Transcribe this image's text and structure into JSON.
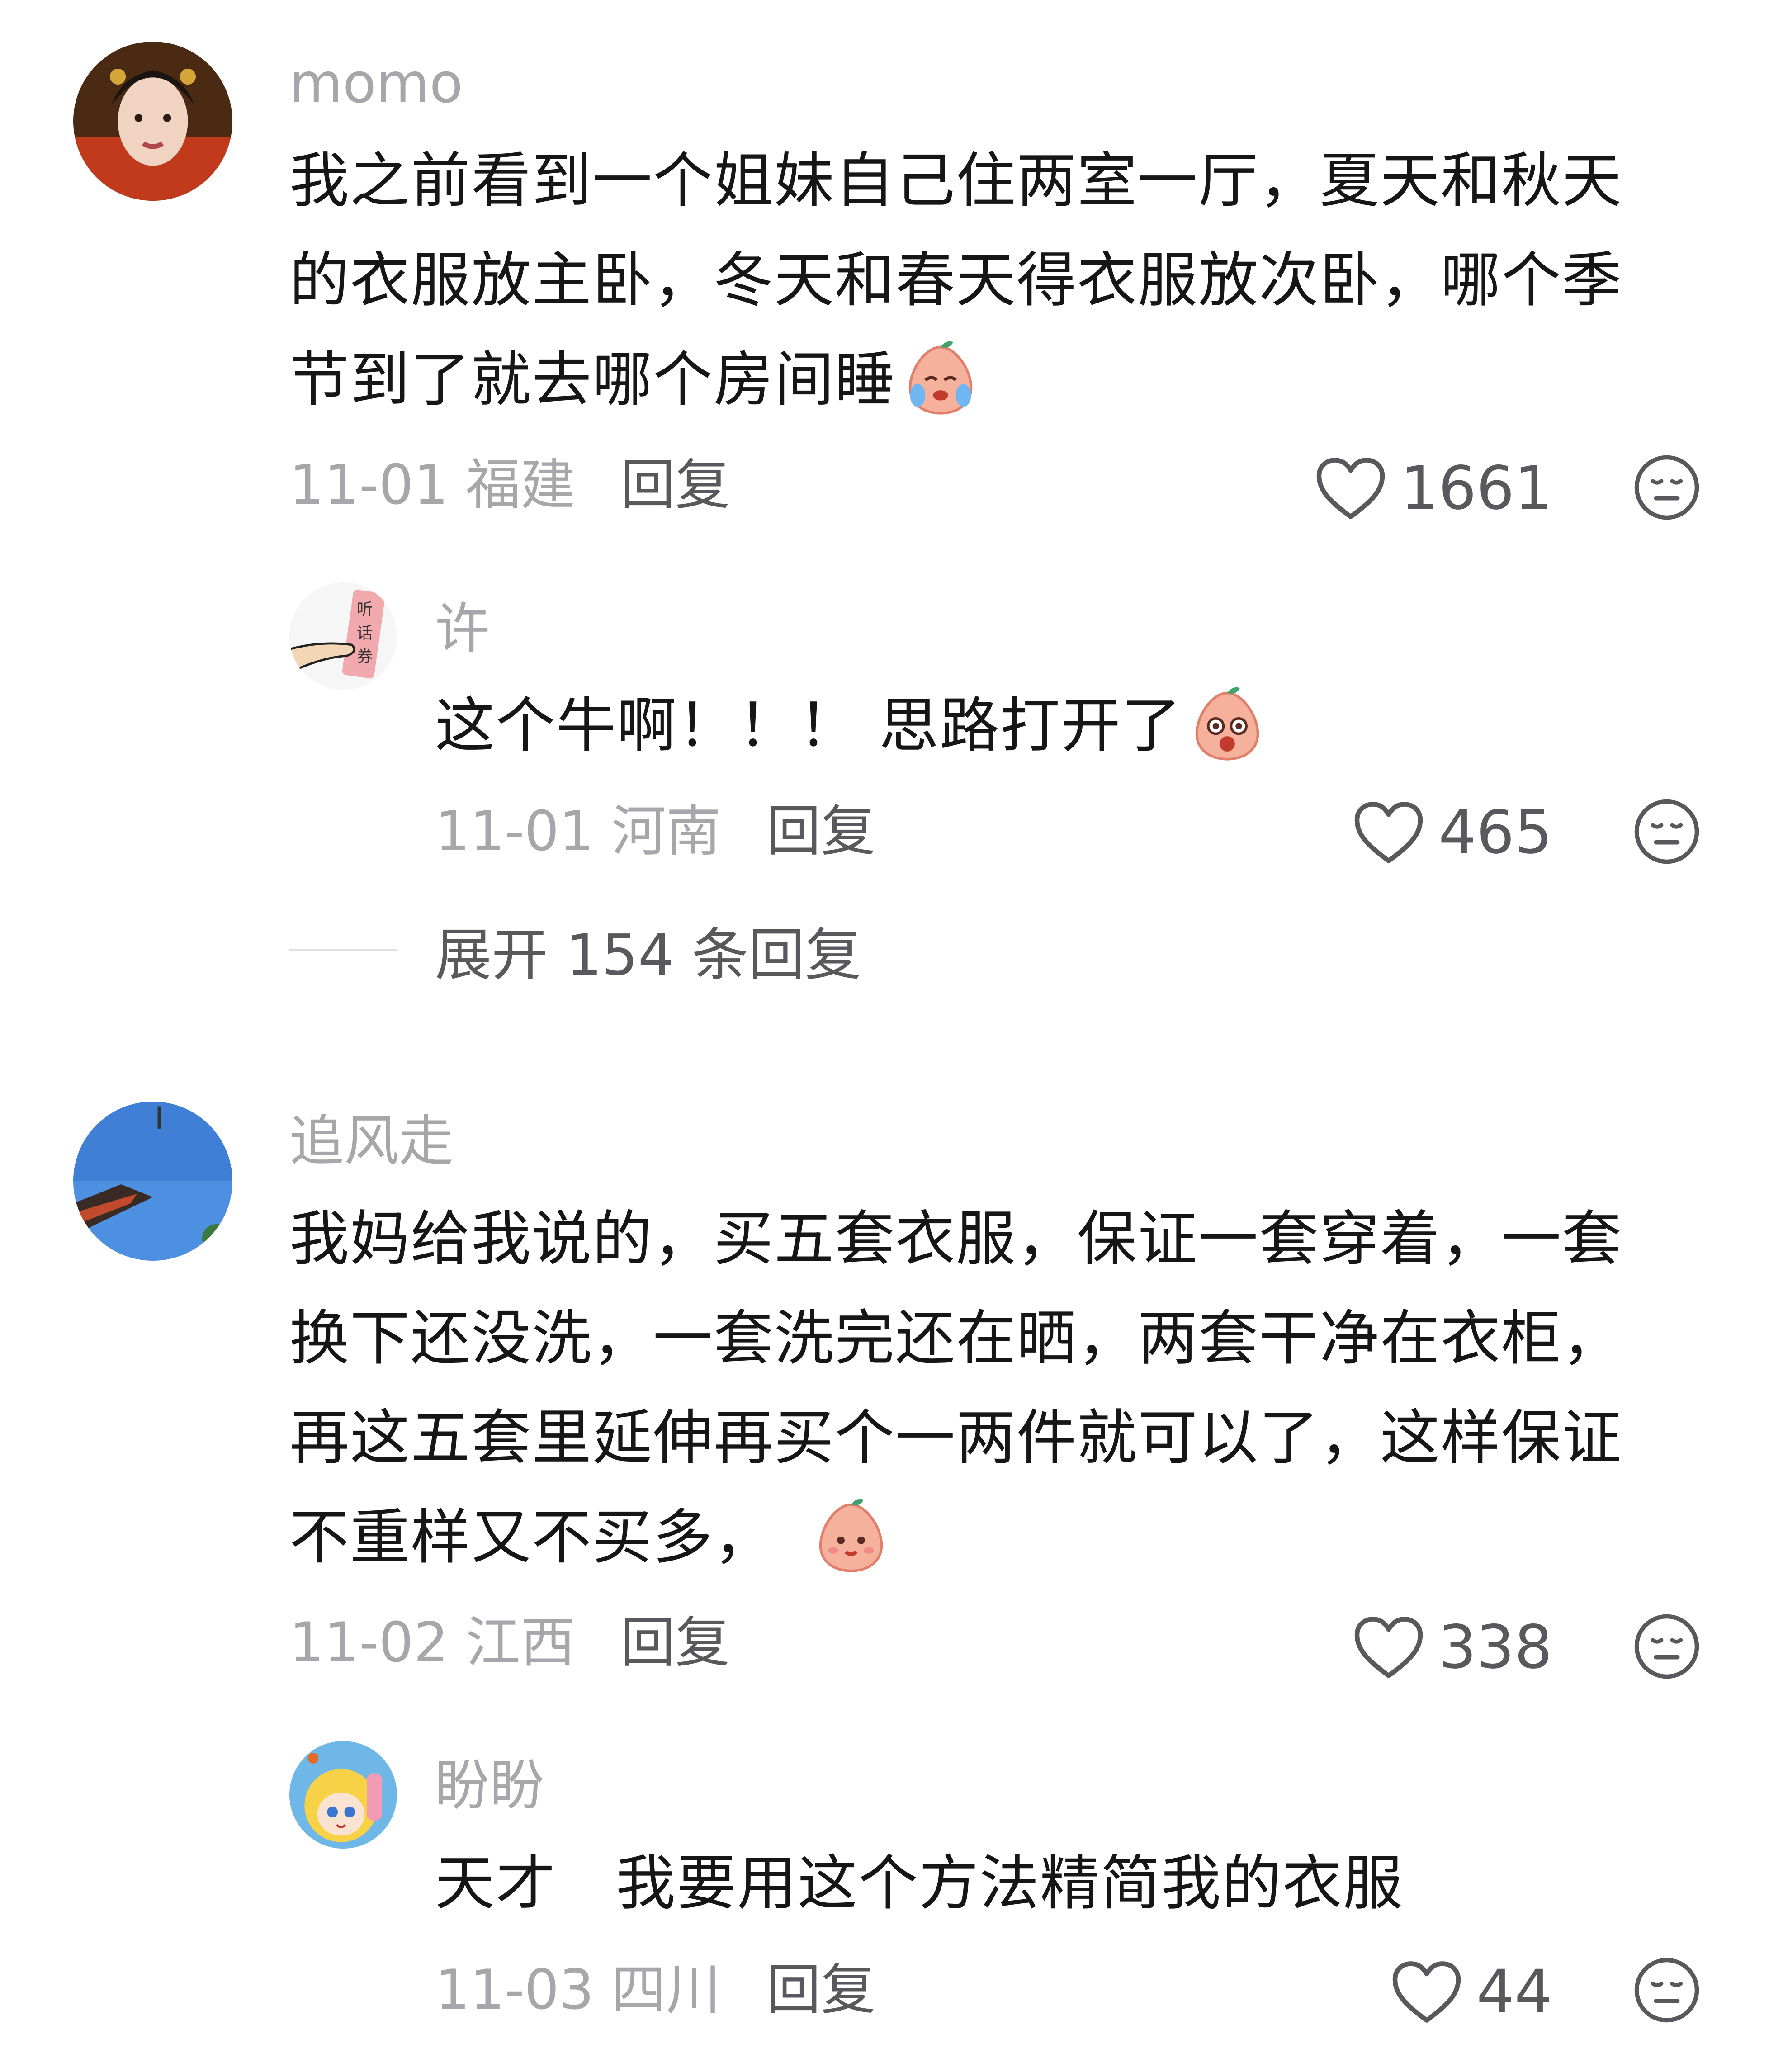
{
  "comments": [
    {
      "username": "momo",
      "text_lines": [
        "我之前看到一个姐妹自己住两室一厅，夏天和秋天",
        "的衣服放主卧，冬天和春天得衣服放次卧，哪个季",
        "节到了就去哪个房间睡"
      ],
      "date_location": "11-01 福建",
      "reply_label": "回复",
      "likes": "1661",
      "replies": [
        {
          "username": "许",
          "avatar_text": "听话券",
          "text_lines": [
            "这个牛啊！！！ 思路打开了"
          ],
          "date_location": "11-01 河南",
          "reply_label": "回复",
          "likes": "465"
        }
      ],
      "expand_label": "展开 154 条回复"
    },
    {
      "username": "追风走",
      "text_lines": [
        "我妈给我说的，买五套衣服，保证一套穿着，一套",
        "换下还没洗，一套洗完还在晒，两套干净在衣柜，",
        "再这五套里延伸再买个一两件就可以了，这样保证",
        "不重样又不买多，"
      ],
      "date_location": "11-02 江西",
      "reply_label": "回复",
      "likes": "338",
      "replies": [
        {
          "username": "盼盼",
          "text_lines": [
            "天才   我要用这个方法精简我的衣服"
          ],
          "date_location": "11-03 四川",
          "reply_label": "回复",
          "likes": "44"
        }
      ]
    }
  ],
  "icons": {
    "like": "heart-outline-icon",
    "dislike": "neutral-face-icon",
    "emoji_cry": "crying-peach-emoji",
    "emoji_shock": "shocked-peach-emoji",
    "emoji_smile": "smiling-peach-emoji"
  },
  "colors": {
    "text": "#161616",
    "muted": "#a6a6ab",
    "secondary": "#59595d",
    "emoji_peach": "#f4a48f"
  }
}
